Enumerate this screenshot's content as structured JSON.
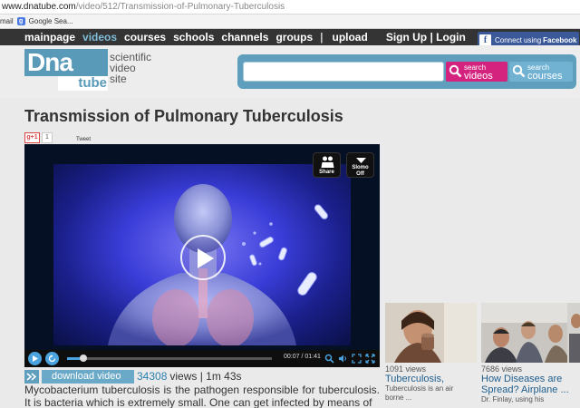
{
  "browser": {
    "url_host": "www.dnatube.com",
    "url_path": "/video/512/Transmission-of-Pulmonary-Tuberculosis",
    "bookmarks": [
      "mail",
      "Google Sea..."
    ]
  },
  "nav": {
    "items": [
      "mainpage",
      "videos",
      "courses",
      "schools",
      "channels",
      "groups"
    ],
    "separator": "|",
    "upload": "upload",
    "signup_login": "Sign Up | Login",
    "facebook_prefix": "Connect using",
    "facebook_bold": "Facebook"
  },
  "logo": {
    "dna": "Dna",
    "tube": "tube",
    "tagline_1": "scientific",
    "tagline_2": "video",
    "tagline_3": "site"
  },
  "search": {
    "placeholder": "",
    "videos_small": "search",
    "videos_big": "videos",
    "courses_small": "search",
    "courses_big": "courses"
  },
  "video": {
    "title": "Transmission of Pulmonary Tuberculosis",
    "gplus_label": "g+1",
    "gplus_count": "1",
    "tweet_label": "Tweet",
    "share_label": "Share",
    "slomo_label_1": "Slomo",
    "slomo_label_2": "Off",
    "progress": 0.08,
    "time": "00:07 / 01:41"
  },
  "stats": {
    "download_label": "download video",
    "view_count": "34308",
    "views_label": "views | 1m 43s"
  },
  "description": "Mycobacterium tuberculosis is the pathogen responsible for tuberculosis. It is bacteria which is extremely small. One can get infected by means of",
  "related": [
    {
      "views": "1091 views",
      "title": "Tuberculosis,",
      "desc_1": "Tuberculosis is an air",
      "desc_2": "borne ..."
    },
    {
      "views": "7686 views",
      "title": "How Diseases are Spread? Airplane ...",
      "desc_1": "Dr. Finlay, using his",
      "desc_2": ""
    }
  ],
  "colors": {
    "accent_blue": "#5f9fbd",
    "search_videos": "#d4237e",
    "nav_bg": "#343434",
    "facebook": "#3b5998"
  }
}
